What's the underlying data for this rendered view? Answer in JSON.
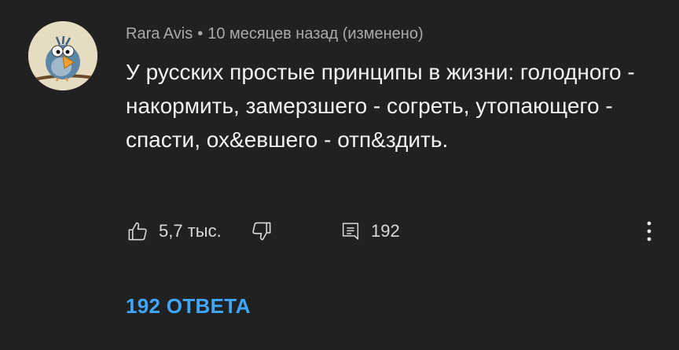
{
  "comment": {
    "author": "Rara Avis",
    "separator": "•",
    "timestamp": "10 месяцев назад (изменено)",
    "text": "У русских простые принципы в жизни: голодного - накормить, замерзшего - согреть, утопающего - спасти, ох&евшего - отп&здить.",
    "likes": "5,7 тыс.",
    "reply_count": "192",
    "replies_label": "192 ОТВЕТА"
  },
  "icons": {
    "like": "thumb-up-icon",
    "dislike": "thumb-down-icon",
    "reply": "reply-comment-icon",
    "more": "more-vertical-icon"
  },
  "colors": {
    "background": "#212121",
    "text": "#f1f1f1",
    "meta": "#aaaaaa",
    "link": "#3ea6ff"
  }
}
